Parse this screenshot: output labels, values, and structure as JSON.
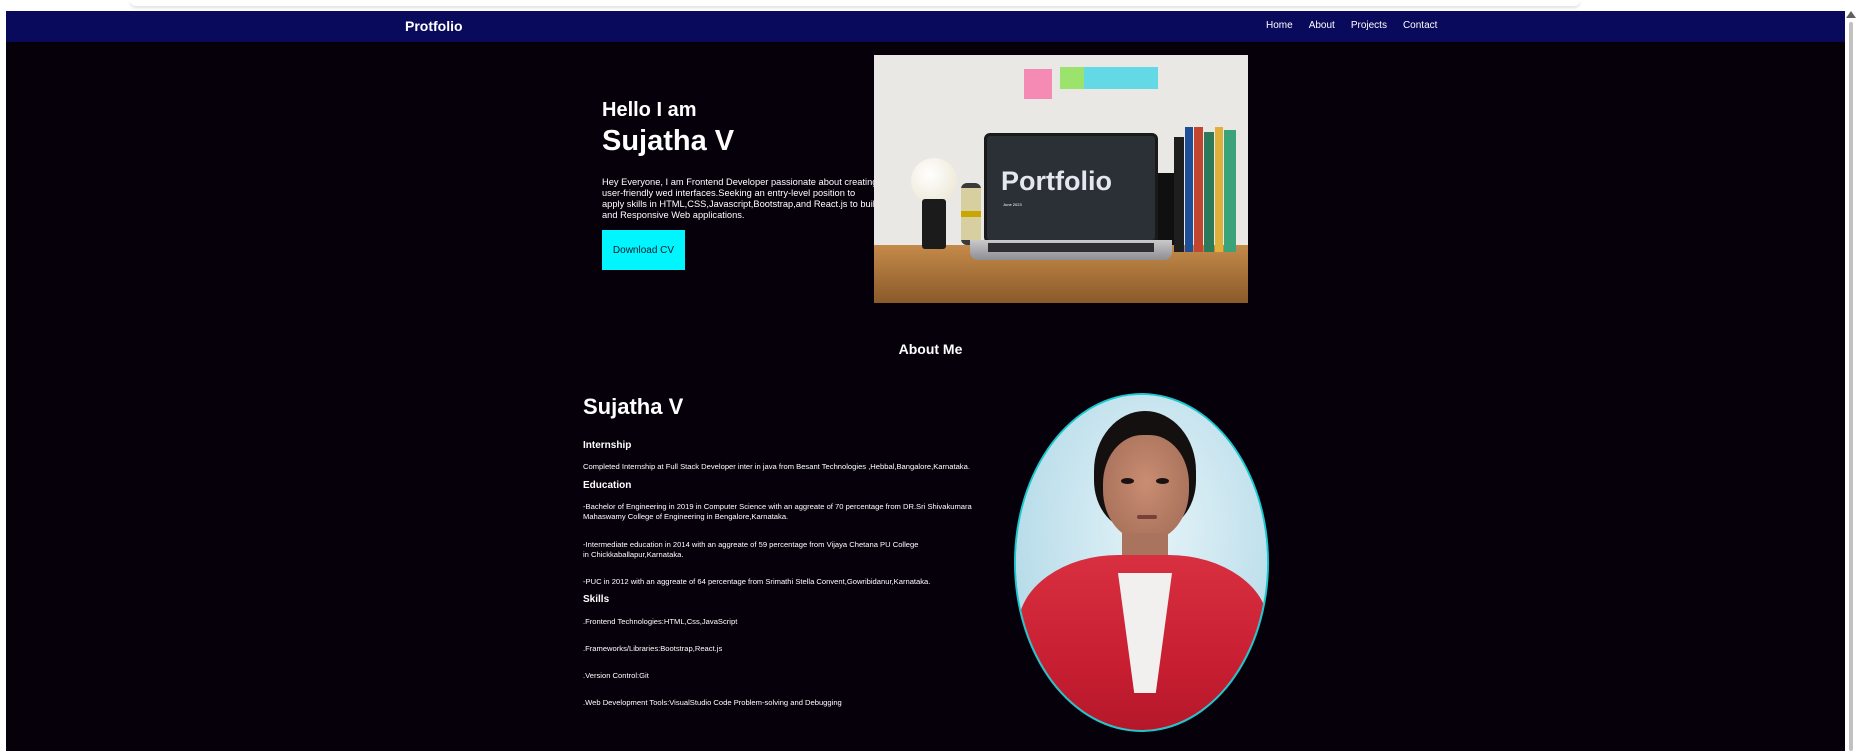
{
  "navbar": {
    "brand": "Protfolio",
    "links": [
      "Home",
      "About",
      "Projects",
      "Contact"
    ]
  },
  "hero": {
    "greeting": "Hello I am",
    "name": "Sujatha V",
    "intro": "Hey Everyone, I am Frontend Developer passionate about creating user-friendly wed interfaces.Seeking an entry-level position to apply skills in HTML,CSS,Javascript,Bootstrap,and React.js to build and Responsive Web applications.",
    "cv_button": "Download CV",
    "image_text": "Portfolio",
    "image_subtext": "June 2023"
  },
  "about": {
    "title": "About Me",
    "name": "Sujatha V",
    "internship_title": "Internship",
    "internship": "Completed Internship at Full Stack Developer inter in java from Besant Technologies ,Hebbal,Bangalore,Karnataka.",
    "education_title": "Education",
    "education": [
      [
        "-Bachelor of Engineering in 2019 in Computer Science with an aggreate of 70 percentage from DR.Sri Shivakumara",
        "Mahaswamy College of Engineering in Bengalore,Karnataka."
      ],
      [
        "-Intermediate education in 2014 with an aggreate of 59 percentage from Vijaya Chetana PU College",
        "in Chickkaballapur,Karnataka."
      ],
      [
        "-PUC in 2012 with an aggreate of 64 percentage from Srimathi Stella Convent,Gowribidanur,Karnataka."
      ]
    ],
    "skills_title": "Skills",
    "skills": [
      ".Frontend Technologies:HTML,Css,JavaScript",
      ".Frameworks/Libraries:Bootstrap,React.js",
      ".Version Control:Git",
      ".Web Development Tools:VisualStudio Code Problem-solving and Debugging"
    ]
  },
  "colors": {
    "navbar": "#0a0a5c",
    "background": "#05000a",
    "button": "#00f5ff",
    "photo_border": "#19c9cf"
  }
}
